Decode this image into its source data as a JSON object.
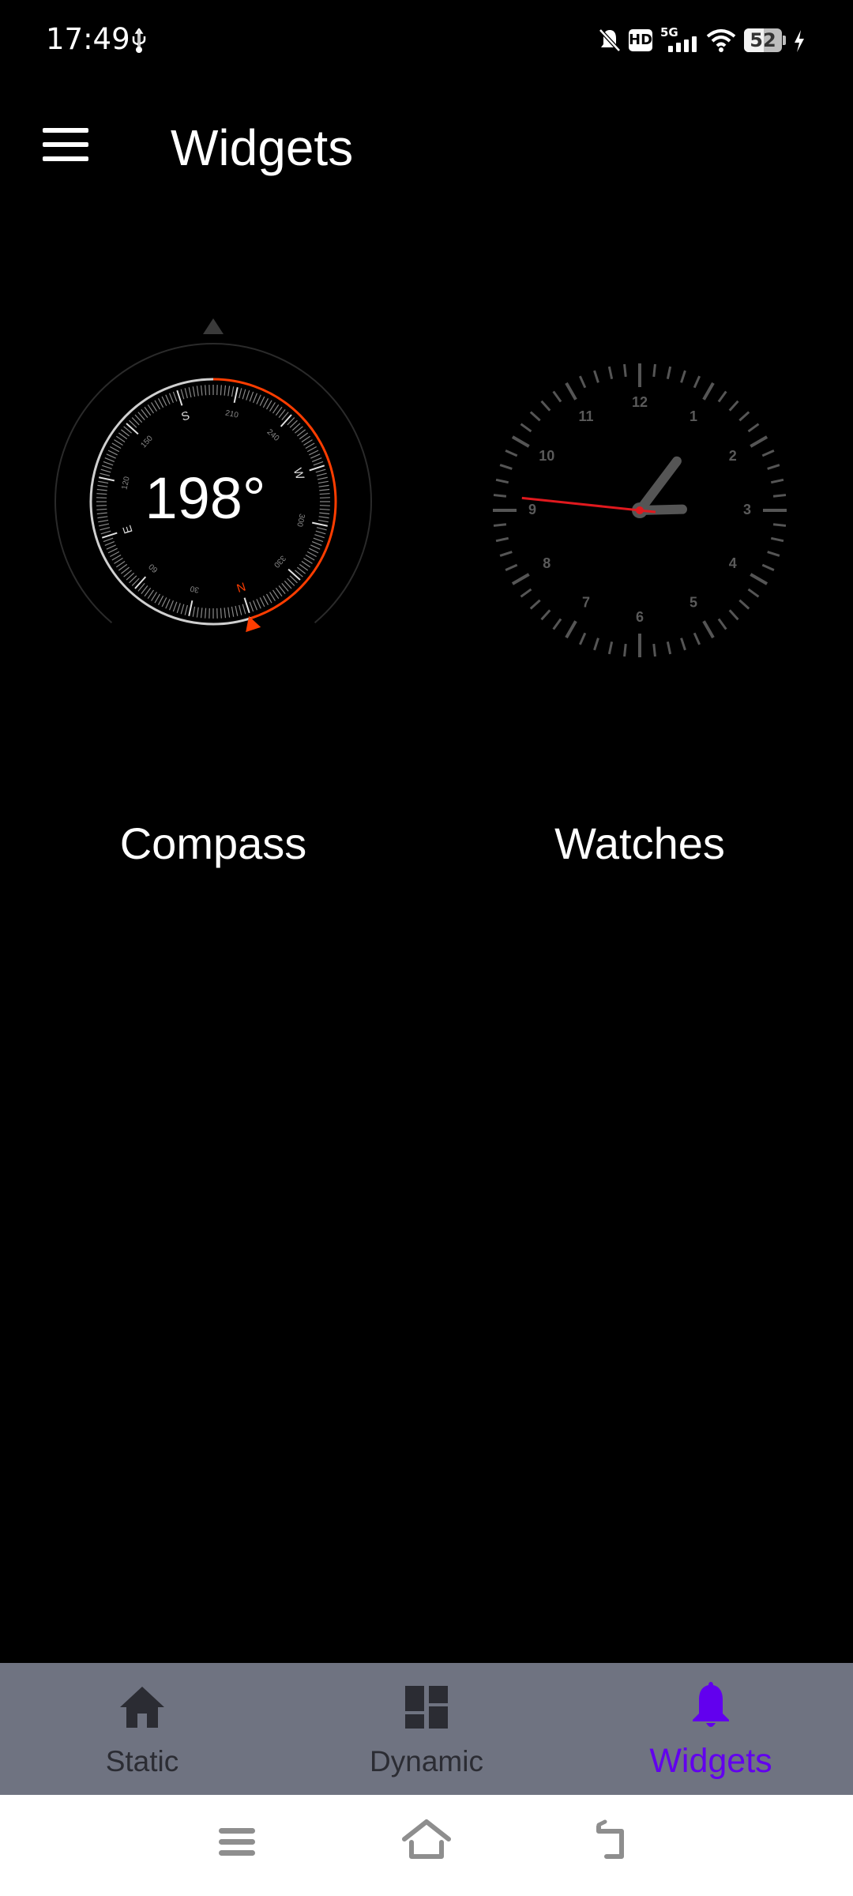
{
  "status_bar": {
    "time": "17:49",
    "left_icons": [
      "usb-icon"
    ],
    "right_icons": [
      "notifications-off-icon",
      "hd-icon",
      "5g-signal-icon",
      "wifi-icon",
      "battery-icon",
      "charging-icon"
    ],
    "network": "5G",
    "hd": "HD",
    "battery_percent": "52"
  },
  "app_bar": {
    "menu_icon": "hamburger-menu-icon",
    "title": "Widgets"
  },
  "widgets": [
    {
      "label": "Compass",
      "heading": "198°",
      "cardinals": {
        "N": "N",
        "E": "E",
        "S": "S",
        "W": "W"
      },
      "degree_labels": [
        "30",
        "60",
        "120",
        "150",
        "210",
        "240",
        "300",
        "330"
      ],
      "accent_color": "#ff3d00"
    },
    {
      "label": "Watches",
      "hour_numbers": [
        "12",
        "1",
        "2",
        "3",
        "4",
        "5",
        "6",
        "7",
        "8",
        "9",
        "10",
        "11"
      ],
      "time": {
        "hours": 1,
        "minutes": 14,
        "seconds": 46
      },
      "second_hand_color": "#e0191e"
    }
  ],
  "bottom_nav": {
    "items": [
      {
        "label": "Static",
        "icon": "home-icon",
        "active": false
      },
      {
        "label": "Dynamic",
        "icon": "dashboard-icon",
        "active": false
      },
      {
        "label": "Widgets",
        "icon": "bell-icon",
        "active": true
      }
    ],
    "active_color": "#6200ee"
  },
  "system_nav": {
    "buttons": [
      "recents-menu-icon",
      "home-outline-icon",
      "back-icon"
    ]
  }
}
